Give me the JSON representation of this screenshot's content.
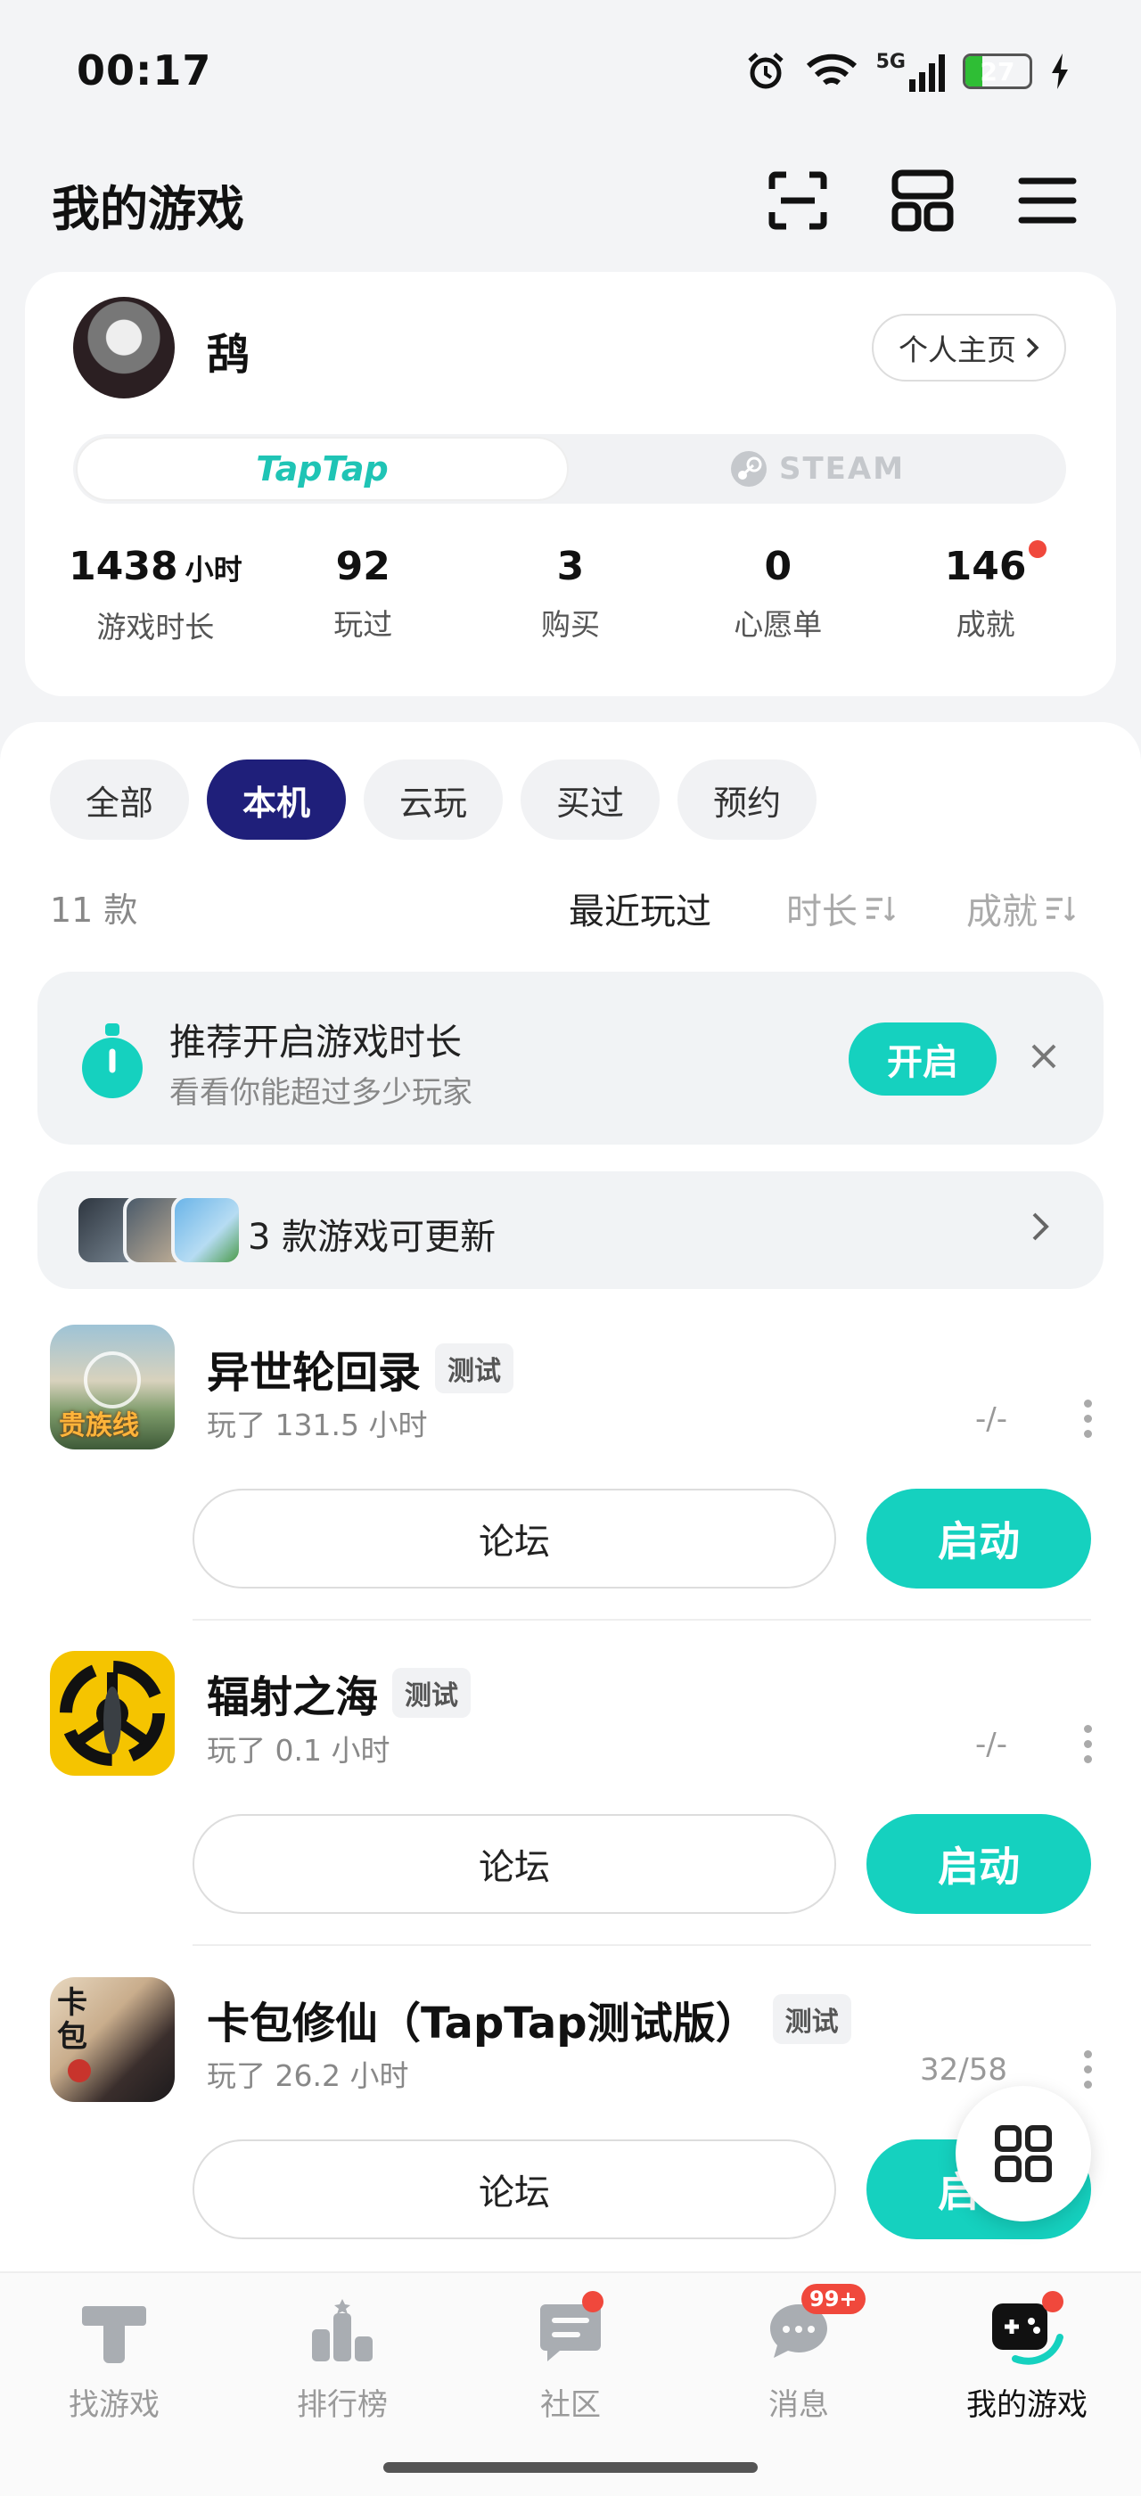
{
  "status_bar": {
    "time": "00:17",
    "network": "5G",
    "battery": "27",
    "battery_level": 0.27
  },
  "header": {
    "title": "我的游戏"
  },
  "profile": {
    "name": "鸹",
    "home_button": "个人主页",
    "platforms": {
      "active": "TapTap",
      "inactive": "STEAM"
    },
    "stats": [
      {
        "value": "1438",
        "unit": "小时",
        "label": "游戏时长"
      },
      {
        "value": "92",
        "unit": "",
        "label": "玩过"
      },
      {
        "value": "3",
        "unit": "",
        "label": "购买"
      },
      {
        "value": "0",
        "unit": "",
        "label": "心愿单"
      },
      {
        "value": "146",
        "unit": "",
        "label": "成就"
      }
    ]
  },
  "filters": [
    {
      "label": "全部",
      "active": false
    },
    {
      "label": "本机",
      "active": true
    },
    {
      "label": "云玩",
      "active": false
    },
    {
      "label": "买过",
      "active": false
    },
    {
      "label": "预约",
      "active": false
    }
  ],
  "list_meta": {
    "count": "11 款",
    "sort_recent": "最近玩过",
    "sort_duration": "时长",
    "sort_achievement": "成就"
  },
  "banner": {
    "title": "推荐开启游戏时长",
    "subtitle": "看看你能超过多少玩家",
    "button": "开启"
  },
  "updates": {
    "text": "3 款游戏可更新"
  },
  "games": [
    {
      "name": "异世轮回录",
      "tag": "测试",
      "play_time": "玩了 131.5 小时",
      "progress": "-/-",
      "icon_text": "贵族线",
      "forum": "论坛",
      "launch": "启动"
    },
    {
      "name": "辐射之海",
      "tag": "测试",
      "play_time": "玩了 0.1 小时",
      "progress": "-/-",
      "icon_text": "",
      "forum": "论坛",
      "launch": "启动"
    },
    {
      "name": "卡包修仙（TapTap测试版）",
      "tag": "测试",
      "play_time": "玩了 26.2 小时",
      "progress": "32/58",
      "icon_text": "卡包",
      "forum": "论坛",
      "launch": "启动"
    }
  ],
  "bottom_nav": [
    {
      "label": "找游戏",
      "icon": "find-game-icon",
      "badge": ""
    },
    {
      "label": "排行榜",
      "icon": "ranking-icon",
      "badge": ""
    },
    {
      "label": "社区",
      "icon": "community-icon",
      "badge": "dot"
    },
    {
      "label": "消息",
      "icon": "message-icon",
      "badge": "99+"
    },
    {
      "label": "我的游戏",
      "icon": "my-games-icon",
      "badge": "dot"
    }
  ],
  "colors": {
    "accent": "#15d1bf",
    "active_chip": "#1f1f7a",
    "badge": "#f0483c"
  }
}
